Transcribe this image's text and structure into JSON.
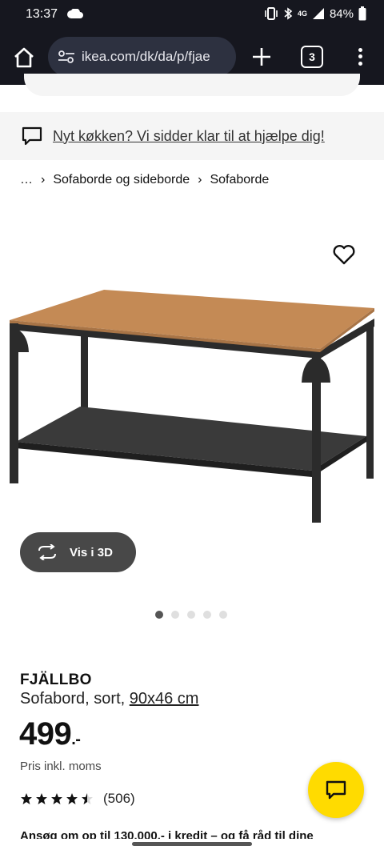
{
  "status_bar": {
    "time": "13:37",
    "network": "4G",
    "battery": "84%"
  },
  "browser": {
    "url": "ikea.com/dk/da/p/fjae",
    "tab_count": "3"
  },
  "banner": {
    "text": "Nyt køkken? Vi sidder klar til at hjælpe dig!"
  },
  "breadcrumb": {
    "items": [
      "…",
      "Sofaborde og sideborde",
      "Sofaborde"
    ]
  },
  "media": {
    "view_3d_label": "Vis i 3D",
    "image_count": 5,
    "active_image_index": 0
  },
  "product": {
    "name": "FJÄLLBO",
    "description": "Sofabord, sort, ",
    "size_link": "90x46 cm",
    "price_main": "499",
    "price_decimal": ".-",
    "price_note": "Pris inkl. moms",
    "rating_value": 4.5,
    "rating_max": 5,
    "review_count": "(506)"
  },
  "credit_text": "Ansøg om op til 130.000,- i kredit – og få råd til dine",
  "colors": {
    "chrome_bg": "#16171f",
    "url_bg": "#2d3140",
    "banner_bg": "#f5f5f5",
    "button_3d_bg": "#484848",
    "chat_fab_bg": "#ffdb00",
    "table_top": "#c48a55"
  },
  "icons": {
    "home": "home-icon",
    "site_settings": "tune-icon",
    "new_tab": "plus-icon",
    "menu": "more-vertical-icon",
    "banner": "chat-bubble-icon",
    "favorite": "heart-icon",
    "view_3d": "rotate-icon",
    "chat": "chat-icon"
  }
}
